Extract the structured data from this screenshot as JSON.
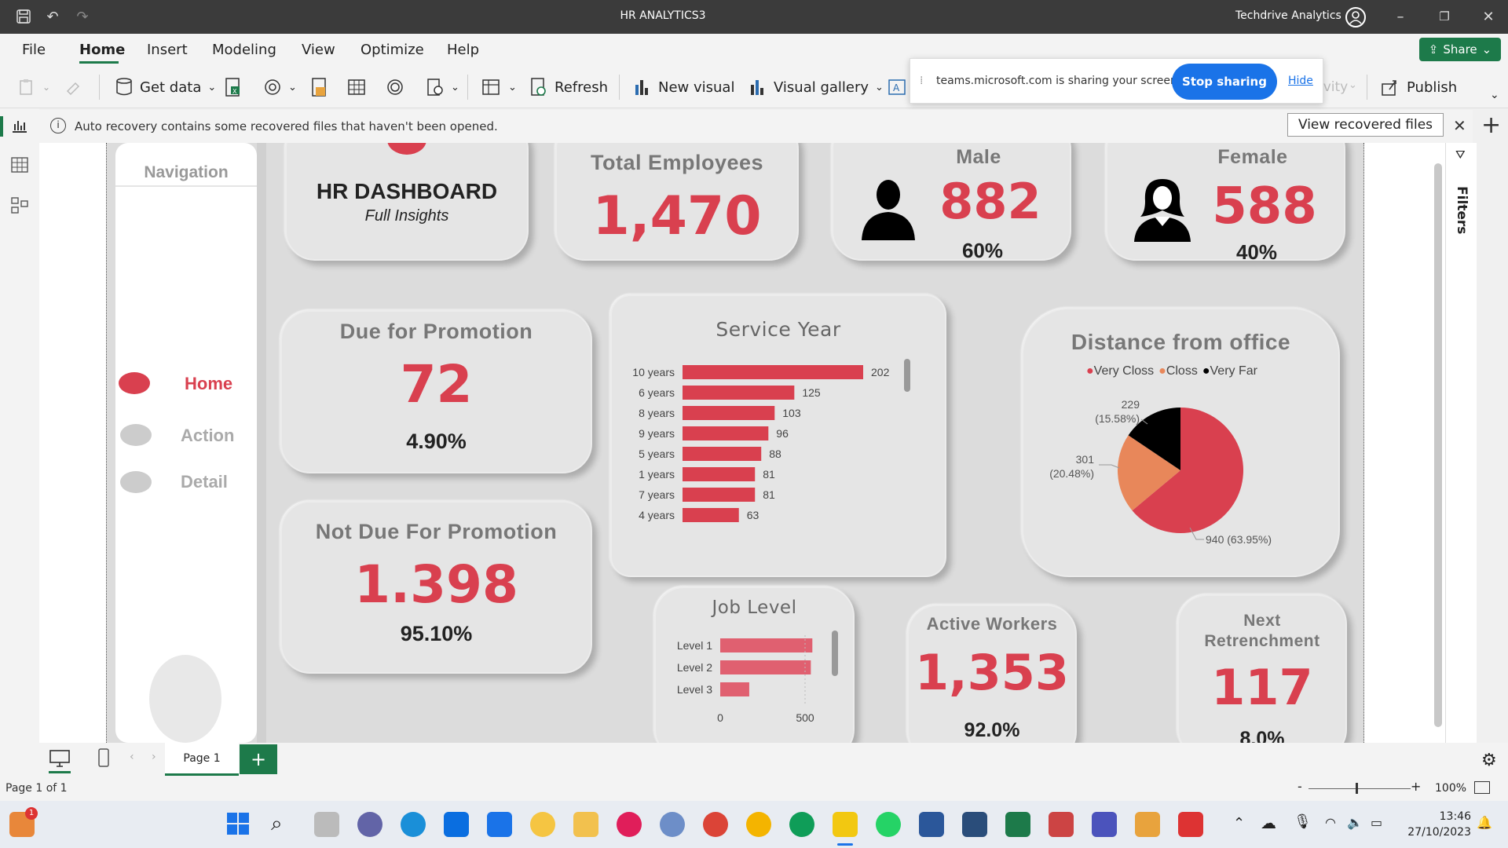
{
  "window": {
    "title": "HR ANALYTICS3",
    "account": "Techdrive Analytics"
  },
  "menu": [
    "File",
    "Home",
    "Insert",
    "Modeling",
    "View",
    "Optimize",
    "Help"
  ],
  "share_label": "Share",
  "ribbon": {
    "get_data": "Get data",
    "refresh": "Refresh",
    "new_visual": "New visual",
    "visual_gallery": "Visual gallery",
    "publish": "Publish",
    "partial_text": "ivity"
  },
  "sharing": {
    "text": "teams.microsoft.com is sharing your screen.",
    "stop": "Stop sharing",
    "hide": "Hide"
  },
  "notice": {
    "text": "Auto recovery contains some recovered files that haven't been opened.",
    "button": "View recovered files"
  },
  "filters_label": "Filters",
  "nav": {
    "title": "Navigation",
    "items": [
      {
        "label": "Home",
        "active": true
      },
      {
        "label": "Action",
        "active": false
      },
      {
        "label": "Detail",
        "active": false
      }
    ]
  },
  "hr_card": {
    "title": "HR DASHBOARD",
    "subtitle": "Full Insights"
  },
  "total": {
    "title": "Total Employees",
    "value": "1,470"
  },
  "male": {
    "title": "Male",
    "value": "882",
    "pct": "60%"
  },
  "female": {
    "title": "Female",
    "value": "588",
    "pct": "40%"
  },
  "due": {
    "title": "Due for Promotion",
    "value": "72",
    "pct": "4.90%"
  },
  "notdue": {
    "title": "Not Due For Promotion",
    "value": "1.398",
    "pct": "95.10%"
  },
  "active": {
    "title": "Active Workers",
    "value": "1,353",
    "pct": "92.0%"
  },
  "retrench": {
    "title_line1": "Next",
    "title_line2": "Retrenchment",
    "value": "117",
    "pct": "8.0%"
  },
  "colors": {
    "accent": "#d9404f",
    "orange": "#e8875a",
    "black": "#000000",
    "excel_green": "#1d7a4a",
    "teams_blue": "#1a73e8"
  },
  "chart_data": [
    {
      "type": "bar",
      "title": "Service Year",
      "categories": [
        "10 years",
        "6 years",
        "8 years",
        "9 years",
        "5 years",
        "1 years",
        "7 years",
        "4 years"
      ],
      "values": [
        202,
        125,
        103,
        96,
        88,
        81,
        81,
        63
      ],
      "orientation": "horizontal",
      "color": "#d9404f"
    },
    {
      "type": "pie",
      "title": "Distance from office",
      "legend": [
        "Very Closs",
        "Closs",
        "Very Far"
      ],
      "values": [
        940,
        301,
        229
      ],
      "labels": [
        "940 (63.95%)",
        "301",
        "(20.48%)",
        "229",
        "(15.58%)"
      ],
      "colors": [
        "#d9404f",
        "#e8875a",
        "#000000"
      ],
      "legend_position": "top"
    },
    {
      "type": "bar",
      "title": "Job Level",
      "categories": [
        "Level 1",
        "Level 2",
        "Level 3"
      ],
      "values": [
        543,
        534,
        171
      ],
      "orientation": "horizontal",
      "xlim": [
        0,
        600
      ],
      "xticks": [
        "0",
        "500"
      ],
      "color": "#e06070"
    }
  ],
  "pagebar": {
    "page": "Page 1",
    "status": "Page 1 of 1",
    "zoom": "100%"
  },
  "clock": {
    "time": "13:46",
    "date": "27/10/2023"
  }
}
